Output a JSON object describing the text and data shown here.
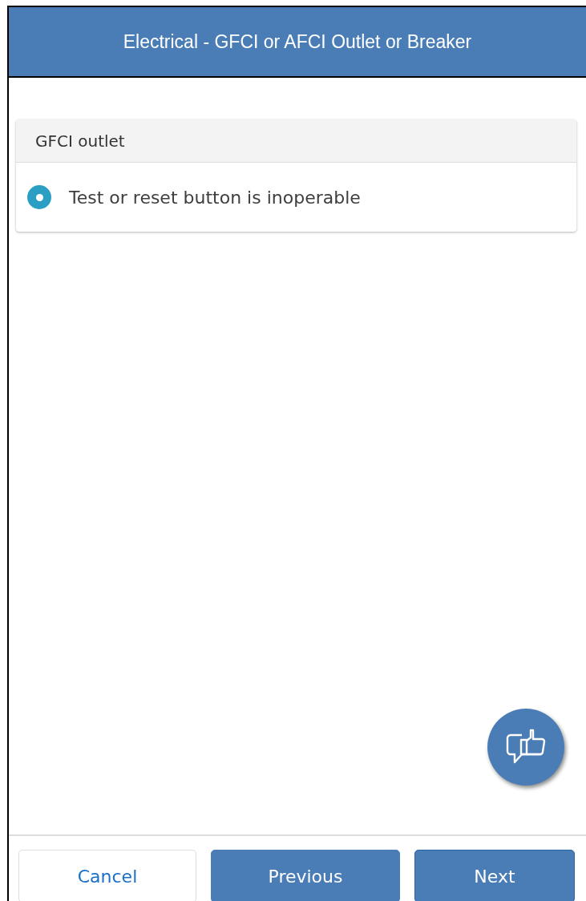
{
  "header": {
    "title": "Electrical - GFCI or AFCI Outlet or Breaker"
  },
  "section": {
    "title": "GFCI outlet",
    "options": [
      {
        "label": "Test or reset button is inoperable",
        "selected": true
      }
    ]
  },
  "buttons": [
    {
      "label": "Cancel",
      "kind": "neutral"
    },
    {
      "label": "Previous",
      "kind": "brand"
    },
    {
      "label": "Next",
      "kind": "brand"
    }
  ]
}
